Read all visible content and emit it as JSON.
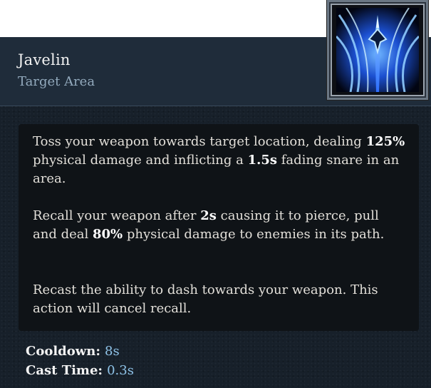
{
  "ability": {
    "name": "Javelin",
    "targeting": "Target Area",
    "icon": "javelin-ability-icon"
  },
  "description": {
    "p1": [
      {
        "text": "Toss your weapon towards target location, dealing ",
        "hl": false
      },
      {
        "text": "125%",
        "hl": true
      },
      {
        "text": " physical damage and inflicting a ",
        "hl": false
      },
      {
        "text": "1.5s",
        "hl": true
      },
      {
        "text": " fading snare in an area.",
        "hl": false
      }
    ],
    "p2": [
      {
        "text": "Recall your weapon after ",
        "hl": false
      },
      {
        "text": "2s",
        "hl": true
      },
      {
        "text": " causing it to pierce, pull and deal ",
        "hl": false
      },
      {
        "text": "80%",
        "hl": true
      },
      {
        "text": " physical damage to enemies in its path.",
        "hl": false
      }
    ],
    "p3": [
      {
        "text": "Recast the ability to dash towards your weapon. This action will cancel recall.",
        "hl": false
      }
    ]
  },
  "stats": {
    "cooldown_label": "Cooldown:",
    "cooldown_value": "8s",
    "cast_time_label": "Cast Time:",
    "cast_time_value": "0.3s"
  },
  "colors": {
    "stat_value": "#8fc3e8",
    "subtitle": "#93aabd",
    "panel": "#17202a"
  }
}
